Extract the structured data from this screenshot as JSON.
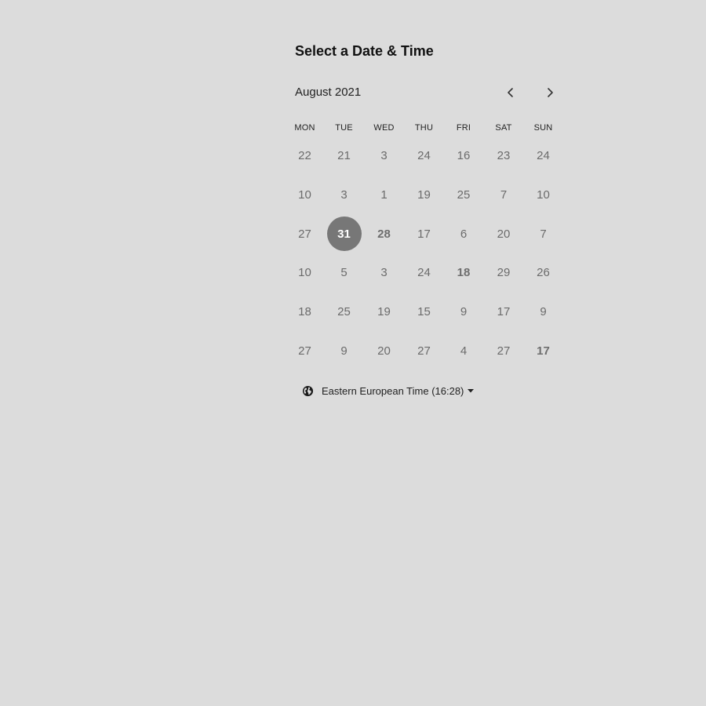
{
  "scheduler": {
    "title": "Select a Date & Time",
    "month_label": "August 2021",
    "nav": {
      "prev_icon": "chevron-left-icon",
      "next_icon": "chevron-right-icon"
    },
    "weekdays": [
      "MON",
      "TUE",
      "WED",
      "THU",
      "FRI",
      "SAT",
      "SUN"
    ],
    "weeks": [
      [
        "22",
        "21",
        "3",
        "24",
        "16",
        "23",
        "24"
      ],
      [
        "10",
        "3",
        "1",
        "19",
        "25",
        "7",
        "10"
      ],
      [
        "27",
        "31",
        "28",
        "17",
        "6",
        "20",
        "7"
      ],
      [
        "10",
        "5",
        "3",
        "24",
        "18",
        "29",
        "26"
      ],
      [
        "18",
        "25",
        "19",
        "15",
        "9",
        "17",
        "9"
      ],
      [
        "27",
        "9",
        "20",
        "27",
        "4",
        "27",
        "17"
      ]
    ],
    "selected_day": "31",
    "available_days": [
      "28",
      "18",
      "17"
    ],
    "timezone": {
      "label": "Eastern European Time (16:28)",
      "icon": "globe-icon",
      "caret_icon": "caret-down-icon"
    }
  },
  "colors": {
    "background": "#dcdcdc",
    "selected_fill": "#777777",
    "selected_text": "#ffffff",
    "day_text": "#6b6b6b",
    "heading_text": "#111111"
  }
}
